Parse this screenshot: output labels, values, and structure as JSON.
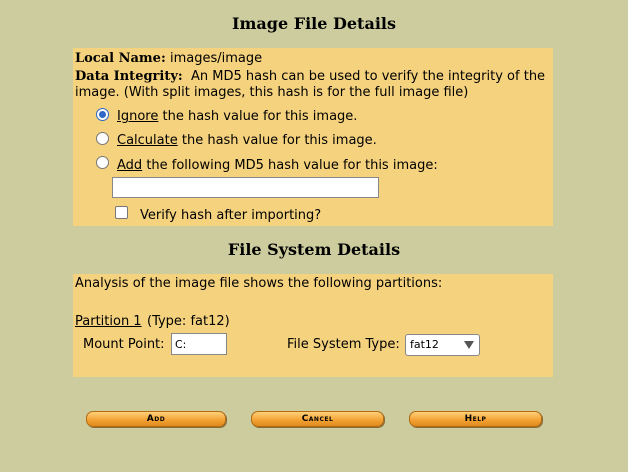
{
  "headings": {
    "image_file_details": "Image File Details",
    "file_system_details": "File System Details"
  },
  "image": {
    "local_name_label": "Local Name:",
    "local_name_value": "images/image",
    "integrity_label": "Data Integrity:",
    "integrity_text_1": "An MD5 hash can be used to verify the integrity of the",
    "integrity_text_2": "image. (With split images, this hash is for the full image file)"
  },
  "hash_options": {
    "ignore_word": "Ignore",
    "ignore_rest": "the hash value for this image.",
    "calculate_word": "Calculate",
    "calculate_rest": "the hash value for this image.",
    "add_word": "Add",
    "add_rest": "the following MD5 hash value for this image:",
    "selected": "ignore",
    "md5_value": "",
    "verify_label": "Verify hash after importing?",
    "verify_checked": false
  },
  "file_system": {
    "analysis_text": "Analysis of the image file shows the following partitions:",
    "partition_link": "Partition 1",
    "partition_type": "(Type: fat12)",
    "mount_point_label": "Mount Point:",
    "mount_point_value": "C:",
    "fs_type_label": "File System Type:",
    "fs_type_value": "fat12"
  },
  "buttons": {
    "add": "Add",
    "cancel": "Cancel",
    "help": "Help"
  },
  "colors": {
    "background": "#cccc9e",
    "panel": "#f5d27e",
    "button": "#f2a032"
  }
}
